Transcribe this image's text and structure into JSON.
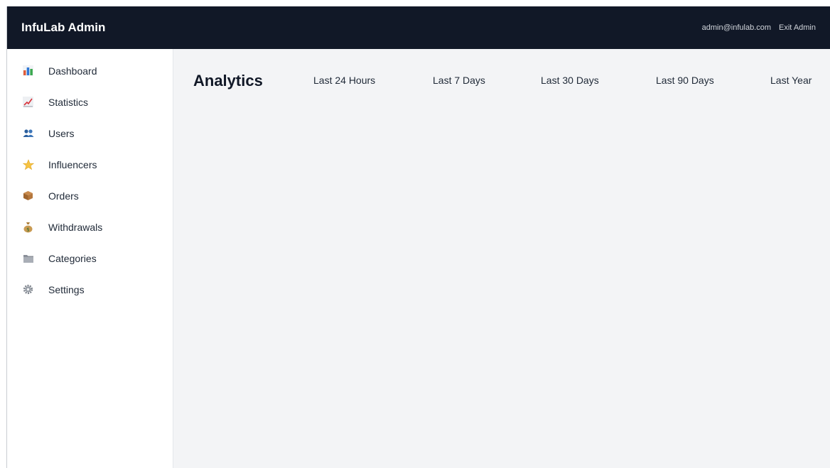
{
  "app": {
    "brand": "InfuLab Admin",
    "user_email": "admin@infulab.com",
    "exit_label": "Exit Admin"
  },
  "sidebar": {
    "items": [
      {
        "label": "Dashboard",
        "icon": "bar-chart-icon"
      },
      {
        "label": "Statistics",
        "icon": "chart-increasing-icon"
      },
      {
        "label": "Users",
        "icon": "users-icon"
      },
      {
        "label": "Influencers",
        "icon": "star-icon"
      },
      {
        "label": "Orders",
        "icon": "package-icon"
      },
      {
        "label": "Withdrawals",
        "icon": "money-bag-icon"
      },
      {
        "label": "Categories",
        "icon": "folder-icon"
      },
      {
        "label": "Settings",
        "icon": "gear-icon"
      }
    ]
  },
  "main": {
    "title": "Analytics",
    "ranges": [
      "Last 24 Hours",
      "Last 7 Days",
      "Last 30 Days",
      "Last 90 Days",
      "Last Year"
    ]
  },
  "colors": {
    "topbar_bg": "#111827",
    "main_bg": "#f3f4f6",
    "sidebar_bg": "#ffffff"
  }
}
